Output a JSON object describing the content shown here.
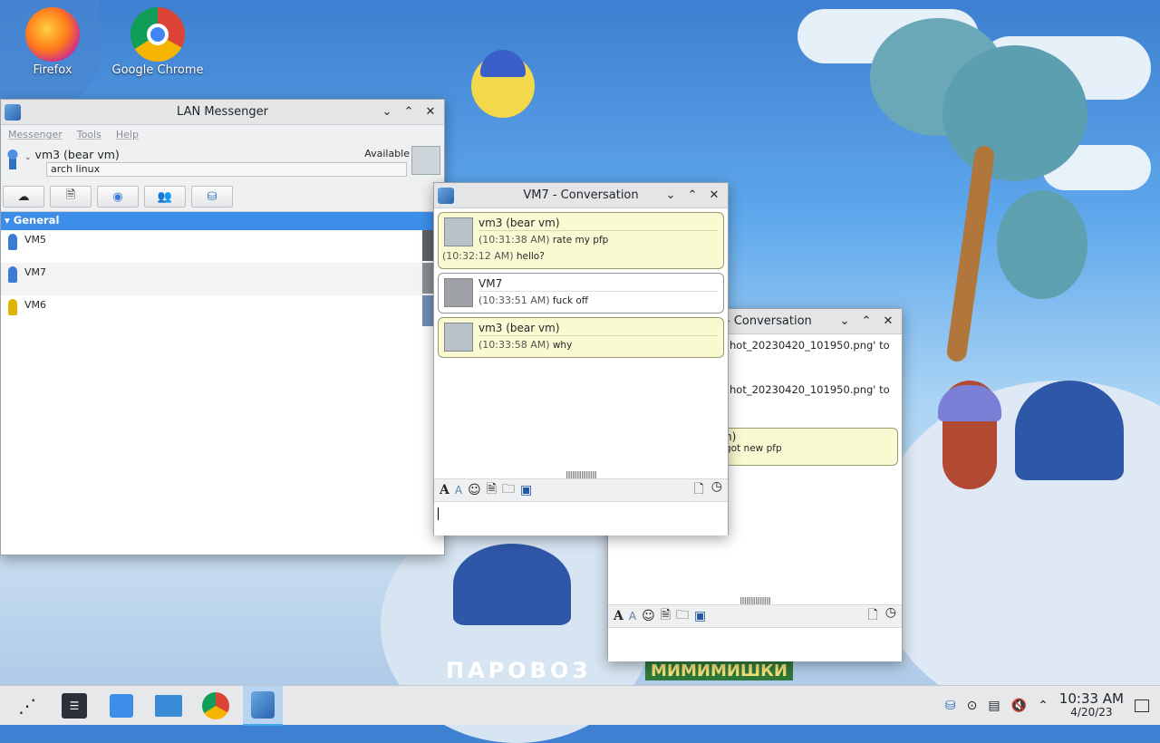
{
  "desktop": {
    "icons": [
      {
        "label": "Firefox"
      },
      {
        "label": "Google Chrome"
      }
    ],
    "wallpaper_text": {
      "brand": "ПАРОВОЗ",
      "show": "МИМИМИШКИ"
    }
  },
  "main_window": {
    "title": "LAN Messenger",
    "menu": [
      "Messenger",
      "Tools",
      "Help"
    ],
    "profile": {
      "name": "vm3 (bear vm)",
      "status": "Available",
      "note": "arch linux"
    },
    "group": "General",
    "contacts": [
      {
        "name": "VM5",
        "status_color": "#3a7bd5"
      },
      {
        "name": "VM7",
        "status_color": "#3a7bd5"
      },
      {
        "name": "VM6",
        "status_color": "#e0b400"
      }
    ]
  },
  "conversation_front": {
    "title": "VM7 - Conversation",
    "messages": [
      {
        "sender": "vm3 (bear vm)",
        "mine": true,
        "lines": [
          {
            "time": "(10:31:38 AM)",
            "text": "rate my pfp"
          },
          {
            "time": "(10:32:12 AM)",
            "text": "hello?"
          }
        ]
      },
      {
        "sender": "VM7",
        "mine": false,
        "lines": [
          {
            "time": "(10:33:51 AM)",
            "text": "fuck off"
          }
        ]
      },
      {
        "sender": "vm3 (bear vm)",
        "mine": true,
        "lines": [
          {
            "time": "(10:33:58 AM)",
            "text": "why"
          }
        ]
      }
    ]
  },
  "conversation_back": {
    "title": "- Conversation",
    "partial_lines": [
      "hot_20230420_101950.png' to",
      "hot_20230420_101950.png' to"
    ],
    "bubble_sender_tail": "n)",
    "bubble_text": "got new pfp"
  },
  "taskbar": {
    "clock_time": "10:33 AM",
    "clock_date": "4/20/23"
  },
  "colors": {
    "accent": "#3d8ee9",
    "bubble_mine": "#fafad2"
  }
}
